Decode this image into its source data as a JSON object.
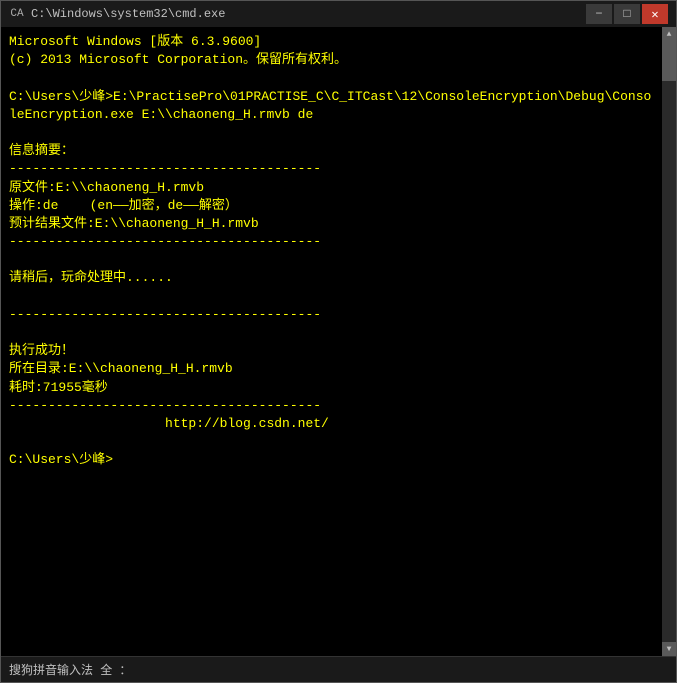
{
  "window": {
    "title": "C:\\Windows\\system32\\cmd.exe",
    "icon": "■"
  },
  "titlebar": {
    "minimize_label": "−",
    "maximize_label": "□",
    "close_label": "✕"
  },
  "terminal": {
    "lines": [
      "Microsoft Windows [版本 6.3.9600]",
      "(c) 2013 Microsoft Corporation。保留所有权利。",
      "",
      "C:\\Users\\少峰>E:\\PractisePro\\01PRACTISE_C\\C_ITCast\\12\\ConsoleEncryption\\Debug\\ConsoleEncryption.exe E:\\\\chaoneng_H.rmvb de",
      "",
      "信息摘要：",
      "----------------------------------------",
      "原文件:E:\\\\chaoneng_H.rmvb",
      "操作:de    (en——加密，de——解密）",
      "预计结果文件:E:\\\\chaoneng_H_H.rmvb",
      "----------------------------------------",
      "",
      "请稍后，玩命处理中......",
      "",
      "----------------------------------------",
      "",
      "执行成功！",
      "所在目录:E:\\\\chaoneng_H_H.rmvb",
      "耗时:71955毫秒",
      "----------------------------------------",
      "                    http://blog.csdn.net/",
      "",
      "C:\\Users\\少峰>"
    ]
  },
  "statusbar": {
    "text": "搜狗拼音输入法  全  ："
  }
}
